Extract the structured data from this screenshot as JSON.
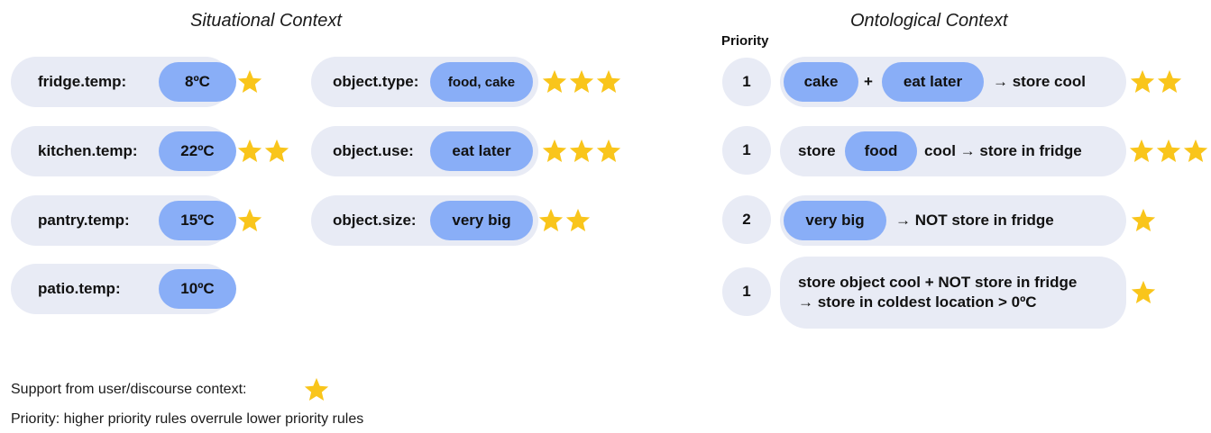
{
  "situational": {
    "title": "Situational Context",
    "left": [
      {
        "label": "fridge.temp:",
        "value": "8ºC",
        "stars": 1
      },
      {
        "label": "kitchen.temp:",
        "value": "22ºC",
        "stars": 2
      },
      {
        "label": "pantry.temp:",
        "value": "15ºC",
        "stars": 1
      },
      {
        "label": "patio.temp:",
        "value": "10ºC",
        "stars": 0
      }
    ],
    "right": [
      {
        "label": "object.type:",
        "value": "food, cake",
        "stars": 3
      },
      {
        "label": "object.use:",
        "value": "eat later",
        "stars": 3
      },
      {
        "label": "object.size:",
        "value": "very big",
        "stars": 2
      }
    ]
  },
  "ontological": {
    "title": "Ontological Context",
    "priority_header": "Priority",
    "rules": [
      {
        "priority": "1",
        "chip1": "cake",
        "plus": "+",
        "chip2": "eat later",
        "result": "→ store cool",
        "stars": 2
      },
      {
        "priority": "1",
        "prefix": "store",
        "chip1": "food",
        "result": "cool → store in fridge",
        "stars": 3
      },
      {
        "priority": "2",
        "chip1": "very big",
        "result": "→ NOT store in fridge",
        "stars": 1
      },
      {
        "priority": "1",
        "line1": "store object cool + NOT store in fridge",
        "line2": "→ store in coldest location > 0ºC",
        "stars": 1
      }
    ]
  },
  "legend": {
    "support": "Support from user/discourse context:",
    "priority": "Priority: higher priority rules overrule lower priority rules"
  },
  "colors": {
    "star": "#f9c51b",
    "chip": "#89aef7",
    "pill": "#e8ebf5"
  }
}
